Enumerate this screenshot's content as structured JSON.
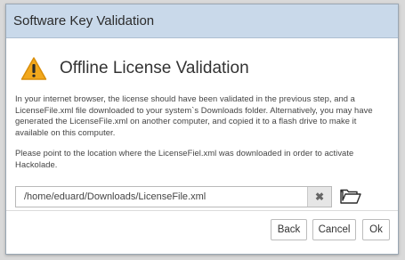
{
  "window": {
    "title": "Software Key Validation"
  },
  "header": {
    "icon": "warning-icon",
    "title": "Offline License Validation"
  },
  "body": {
    "paragraph1": "In your internet browser, the license should have been validated in the previous step, and a LicenseFile.xml file downloaded to your system`s Downloads folder. Alternatively, you may have generated the LicenseFile.xml on another computer, and copied it to a flash drive to make it available on this computer.",
    "paragraph2": "Please point to the location where the LicenseFiel.xml was downloaded in order to activate Hackolade."
  },
  "path_field": {
    "value": "/home/eduard/Downloads/LicenseFile.xml",
    "clear_icon": "close-icon",
    "clear_glyph": "✖",
    "browse_icon": "folder-icon"
  },
  "footer": {
    "back_label": "Back",
    "cancel_label": "Cancel",
    "ok_label": "Ok"
  },
  "colors": {
    "titlebar_bg": "#c9d9ea",
    "warning_fill": "#f2a81c"
  }
}
